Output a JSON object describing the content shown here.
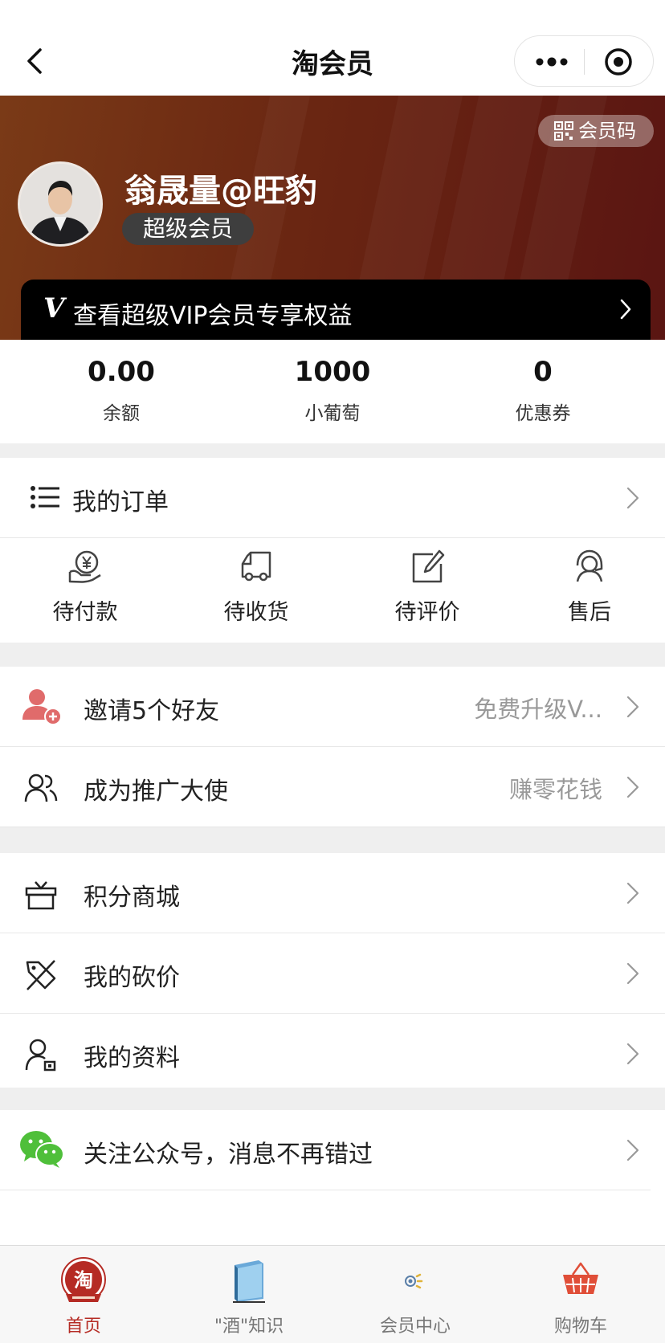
{
  "nav": {
    "title": "淘会员"
  },
  "header": {
    "qr_label": "会员码",
    "username": "翁晟量@旺豹",
    "level": "超级会员",
    "vip_mark": "V",
    "vip_text": "查看超级VIP会员专享权益"
  },
  "stats": [
    {
      "value": "0.00",
      "label": "余额"
    },
    {
      "value": "1000",
      "label": "小葡萄"
    },
    {
      "value": "0",
      "label": "优惠券"
    }
  ],
  "orders": {
    "title": "我的订单",
    "items": [
      {
        "label": "待付款",
        "icon": "yen-payment-icon"
      },
      {
        "label": "待收货",
        "icon": "delivery-truck-icon"
      },
      {
        "label": "待评价",
        "icon": "edit-review-icon"
      },
      {
        "label": "售后",
        "icon": "customer-service-icon"
      }
    ]
  },
  "promo": [
    {
      "label": "邀请5个好友",
      "extra": "免费升级V...",
      "icon": "add-friend-icon"
    },
    {
      "label": "成为推广大使",
      "extra": "赚零花钱",
      "icon": "users-icon"
    }
  ],
  "menu": [
    {
      "label": "积分商城",
      "icon": "gift-icon"
    },
    {
      "label": "我的砍价",
      "icon": "price-tag-icon"
    },
    {
      "label": "我的资料",
      "icon": "profile-icon"
    }
  ],
  "wechat": {
    "label": "关注公众号，消息不再错过",
    "icon": "wechat-icon"
  },
  "tabs": [
    {
      "label": "首页",
      "active": true,
      "icon": "home-logo-icon"
    },
    {
      "label": "\"酒\"知识",
      "active": false,
      "icon": "book-icon"
    },
    {
      "label": "会员中心",
      "active": false,
      "icon": "member-center-icon"
    },
    {
      "label": "购物车",
      "active": false,
      "icon": "shopping-cart-icon"
    }
  ],
  "colors": {
    "accent": "#b52b24",
    "banner_start": "#7a3a17",
    "banner_end": "#5a1512",
    "invite_icon": "#e06b6b",
    "wechat": "#4fbf3a"
  }
}
